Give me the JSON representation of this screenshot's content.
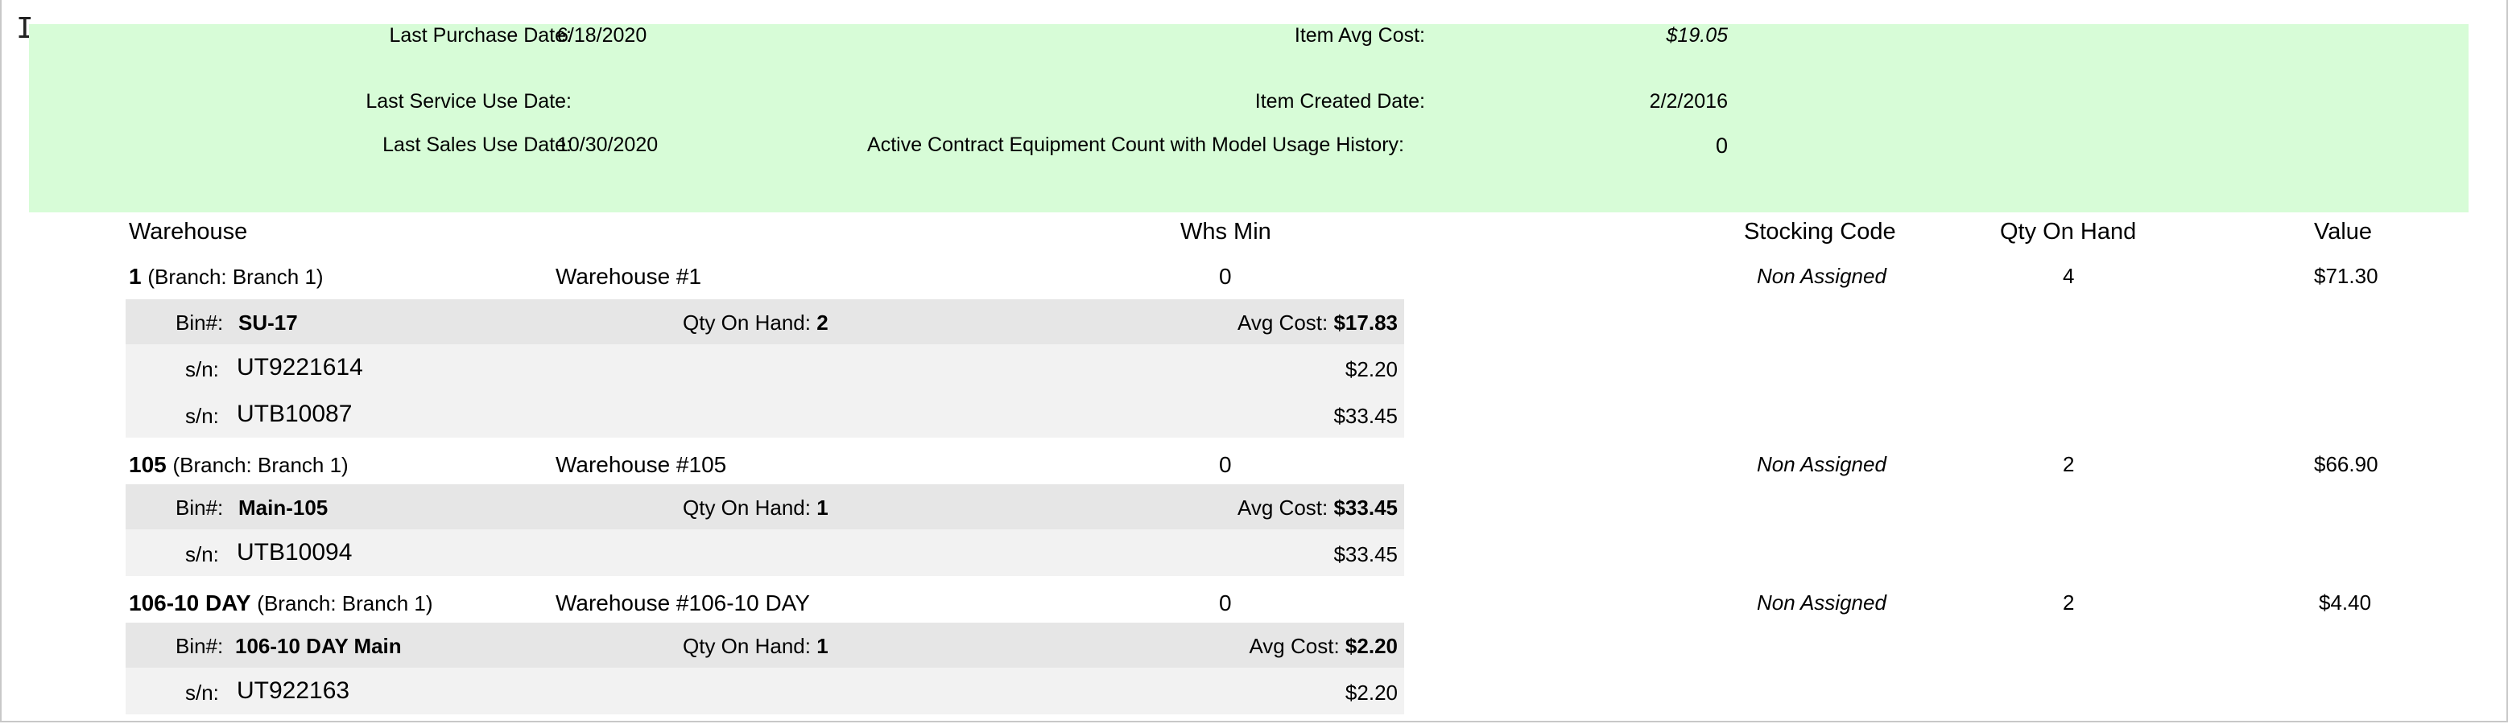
{
  "summary": {
    "last_purchase_date_label": "Last Purchase Date:",
    "last_purchase_date": "6/18/2020",
    "last_service_use_date_label": "Last Service Use Date:",
    "last_service_use_date": "",
    "last_sales_use_date_label": "Last Sales Use Date:",
    "last_sales_use_date": "10/30/2020",
    "item_avg_cost_label": "Item Avg Cost:",
    "item_avg_cost": "$19.05",
    "item_created_date_label": "Item Created Date:",
    "item_created_date": "2/2/2016",
    "active_contract_label": "Active Contract Equipment Count with Model Usage History:",
    "active_contract_count": "0"
  },
  "columns": {
    "warehouse": "Warehouse",
    "whs_min": "Whs Min",
    "stocking_code": "Stocking Code",
    "qty_on_hand": "Qty On Hand",
    "value": "Value"
  },
  "labels": {
    "bin": "Bin#:",
    "qty_on_hand": "Qty On Hand:",
    "avg_cost": "Avg Cost:",
    "sn": "s/n:"
  },
  "warehouses": [
    {
      "code": "1",
      "branch": "(Branch: Branch 1)",
      "name": "Warehouse #1",
      "min": "0",
      "stocking_code": "Non Assigned",
      "qty": "4",
      "value": "$71.30",
      "bin": "SU-17",
      "bin_qty": "2",
      "bin_avg_cost": "$17.83",
      "serials": [
        {
          "sn": "UT9221614",
          "cost": "$2.20"
        },
        {
          "sn": "UTB10087",
          "cost": "$33.45"
        }
      ]
    },
    {
      "code": "105",
      "branch": "(Branch: Branch 1)",
      "name": "Warehouse #105",
      "min": "0",
      "stocking_code": "Non Assigned",
      "qty": "2",
      "value": "$66.90",
      "bin": "Main-105",
      "bin_qty": "1",
      "bin_avg_cost": "$33.45",
      "serials": [
        {
          "sn": "UTB10094",
          "cost": "$33.45"
        }
      ]
    },
    {
      "code": "106-10 DAY",
      "branch": "(Branch: Branch 1)",
      "name": "Warehouse #106-10 DAY",
      "min": "0",
      "stocking_code": "Non Assigned",
      "qty": "2",
      "value": "$4.40",
      "bin": "106-10 DAY Main",
      "bin_qty": "1",
      "bin_avg_cost": "$2.20",
      "serials": [
        {
          "sn": "UT922163",
          "cost": "$2.20"
        }
      ]
    }
  ]
}
